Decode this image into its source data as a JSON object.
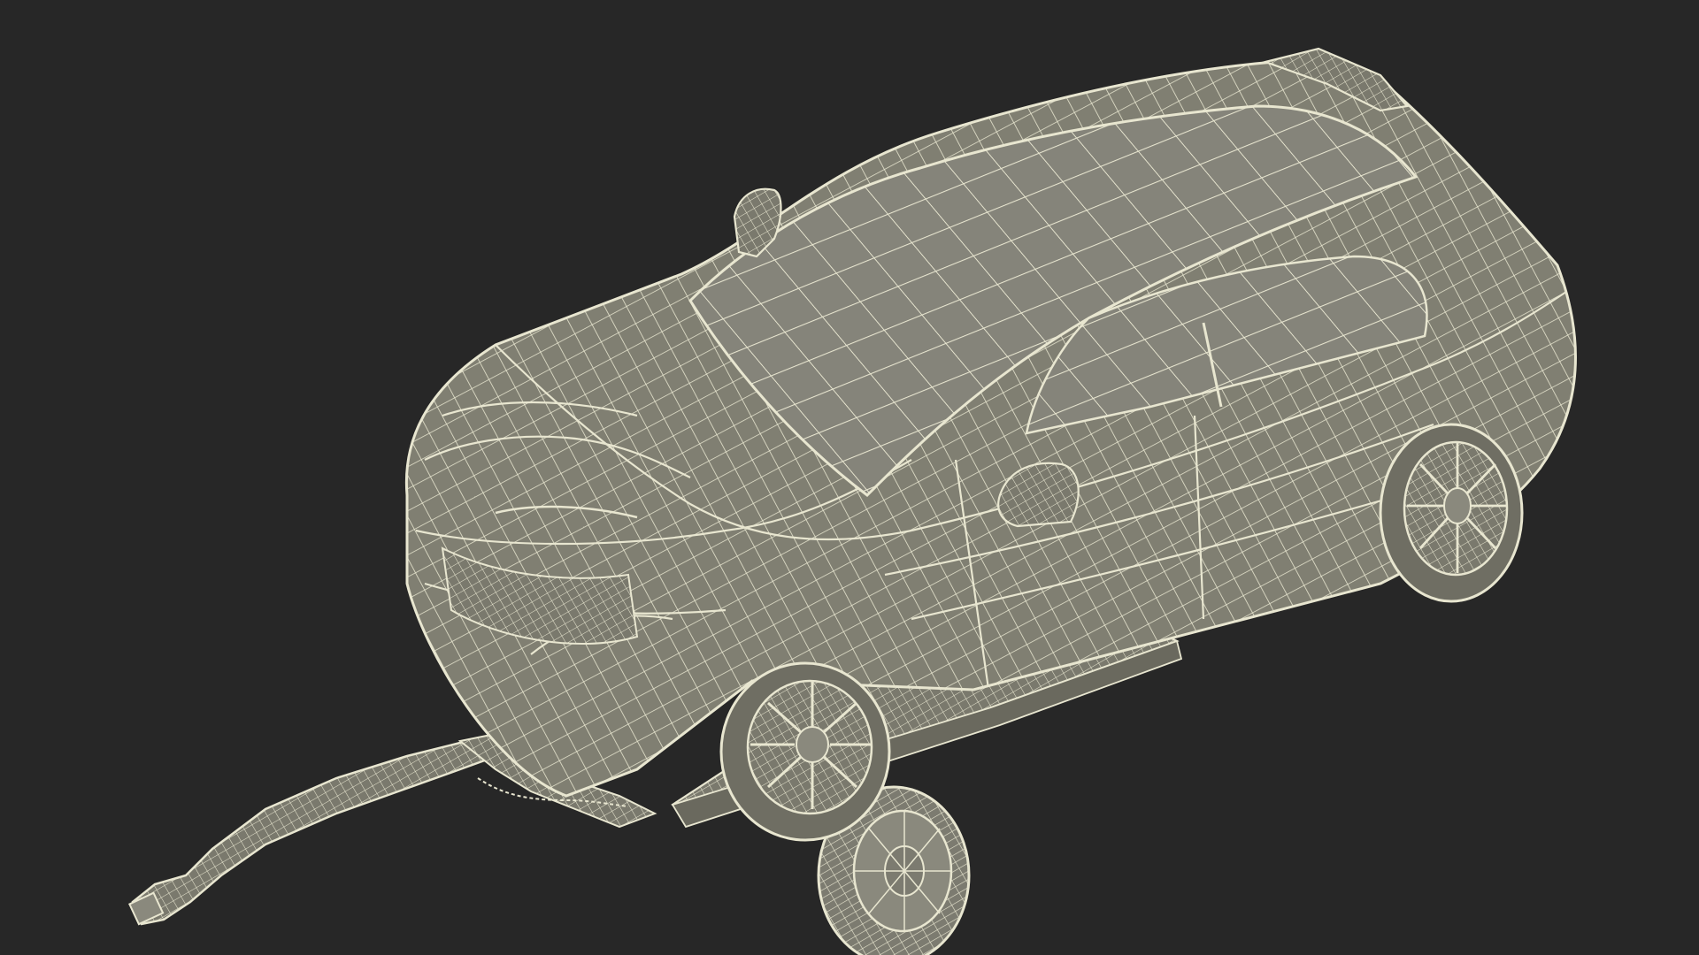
{
  "scene": {
    "background_color": "#272727",
    "surface_color": "#807F72",
    "surface_dark_color": "#5F5E54",
    "wire_color": "#E8E6D0",
    "subject": "wireframe-car-on-tow-dolly"
  }
}
